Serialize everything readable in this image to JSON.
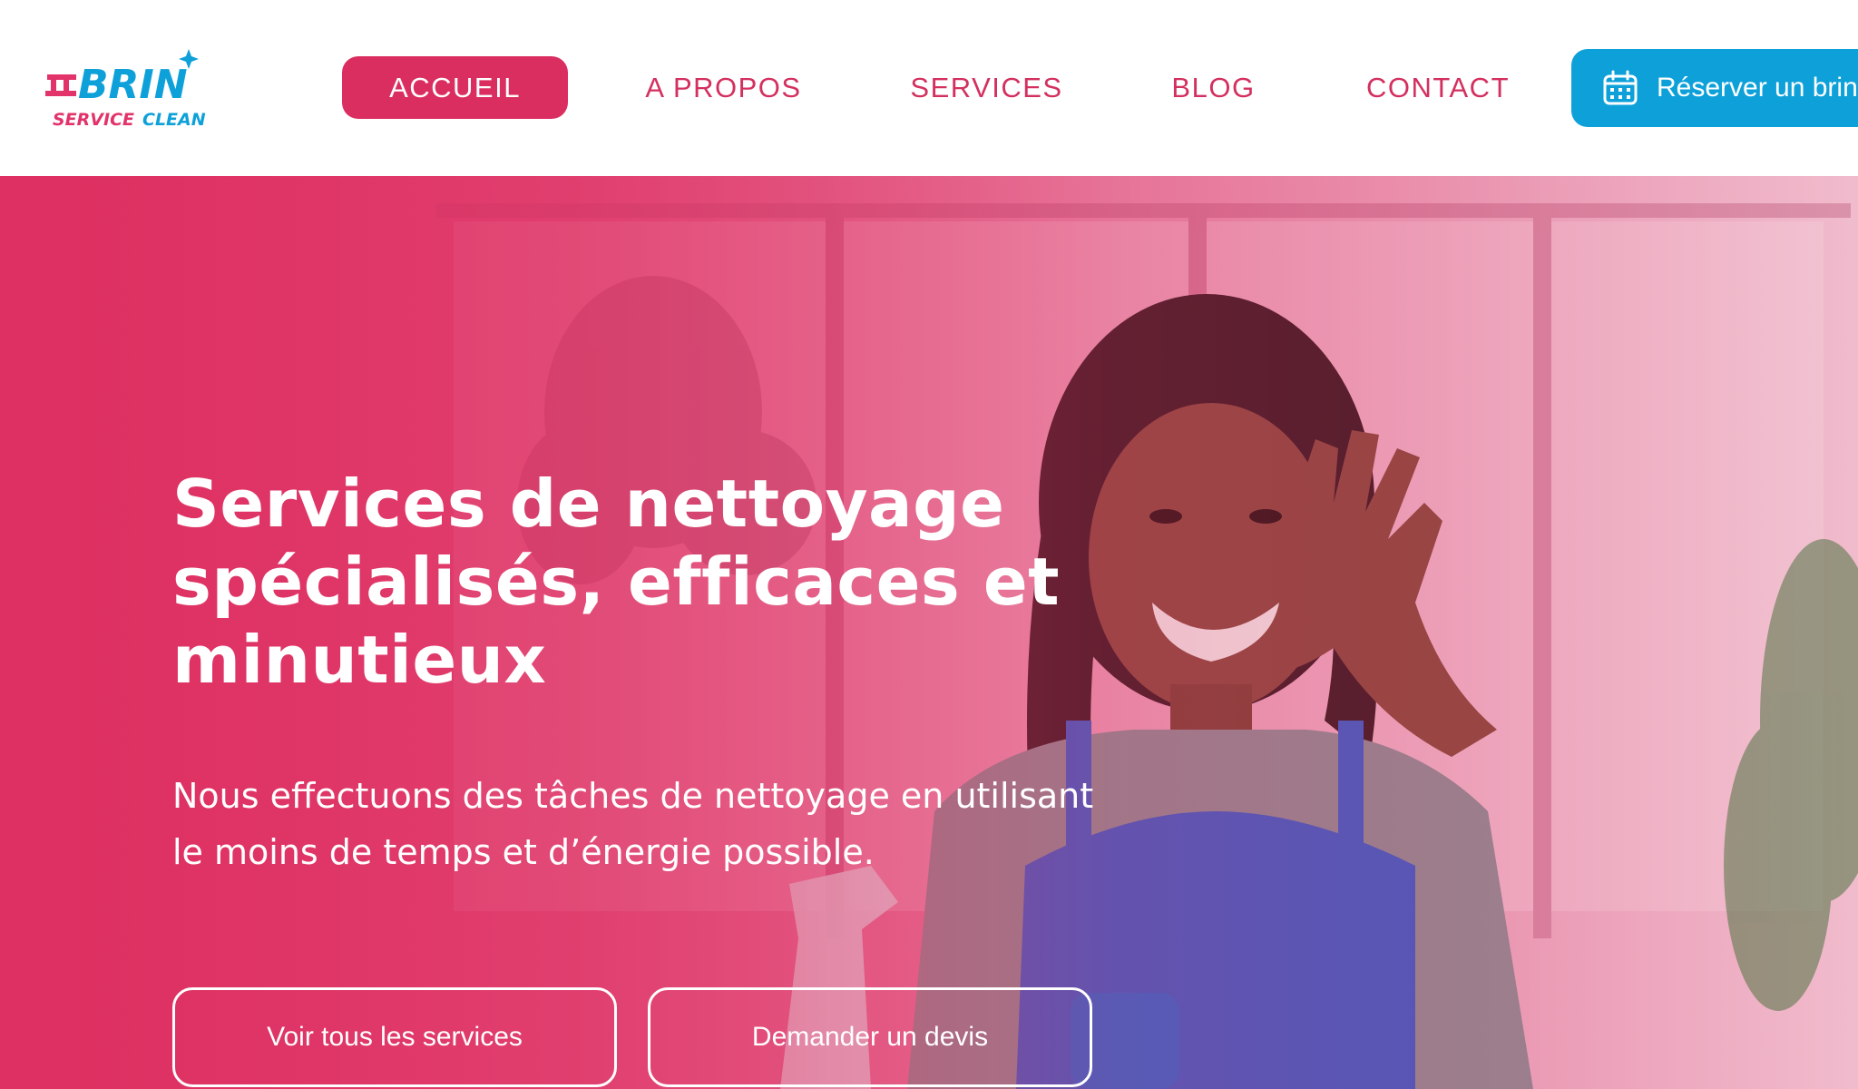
{
  "brand": {
    "logo_wordmark": "BRIN",
    "logo_tagline_1": "SERVICE",
    "logo_tagline_2": "CLEAN",
    "colors": {
      "primary_pink": "#db2e60",
      "accent_blue": "#0ea1d9"
    }
  },
  "nav": {
    "items": [
      {
        "label": "ACCUEIL",
        "active": true
      },
      {
        "label": "A PROPOS",
        "active": false
      },
      {
        "label": "SERVICES",
        "active": false
      },
      {
        "label": "BLOG",
        "active": false
      },
      {
        "label": "CONTACT",
        "active": false
      }
    ],
    "cta": {
      "label": "Réserver un brin",
      "icon": "calendar-icon"
    }
  },
  "hero": {
    "title": "Services de nettoyage spécialisés, efficaces et minutieux",
    "subtitle": "Nous effectuons des tâches de nettoyage en utilisant le moins de temps et d’énergie possible.",
    "buttons": [
      {
        "label": "Voir tous les services"
      },
      {
        "label": "Demander un devis"
      }
    ]
  }
}
